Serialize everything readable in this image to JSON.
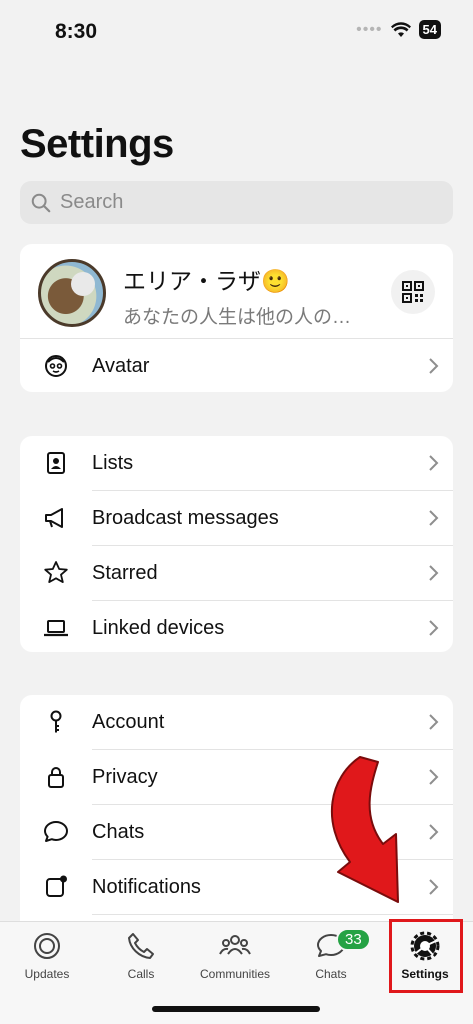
{
  "status_bar": {
    "time": "8:30",
    "battery": "54"
  },
  "page_title": "Settings",
  "search": {
    "placeholder": "Search"
  },
  "profile": {
    "name": "エリア・ラザ🙂",
    "status": "あなたの人生は他の人の…"
  },
  "profile_rows": [
    {
      "label": "Avatar",
      "icon": "avatar-face-icon"
    }
  ],
  "group1": [
    {
      "label": "Lists",
      "icon": "lists-icon"
    },
    {
      "label": "Broadcast messages",
      "icon": "megaphone-icon"
    },
    {
      "label": "Starred",
      "icon": "star-icon"
    },
    {
      "label": "Linked devices",
      "icon": "laptop-icon"
    }
  ],
  "group2": [
    {
      "label": "Account",
      "icon": "key-icon"
    },
    {
      "label": "Privacy",
      "icon": "lock-icon"
    },
    {
      "label": "Chats",
      "icon": "chat-bubble-icon"
    },
    {
      "label": "Notifications",
      "icon": "notification-icon"
    }
  ],
  "tabs": [
    {
      "label": "Updates",
      "icon": "updates-icon"
    },
    {
      "label": "Calls",
      "icon": "phone-icon"
    },
    {
      "label": "Communities",
      "icon": "communities-icon"
    },
    {
      "label": "Chats",
      "icon": "chats-icon",
      "badge": "33"
    },
    {
      "label": "Settings",
      "icon": "settings-gear-icon"
    }
  ],
  "colors": {
    "badge": "#25a244",
    "highlight": "#e0181b",
    "arrow": "#e0181b"
  }
}
